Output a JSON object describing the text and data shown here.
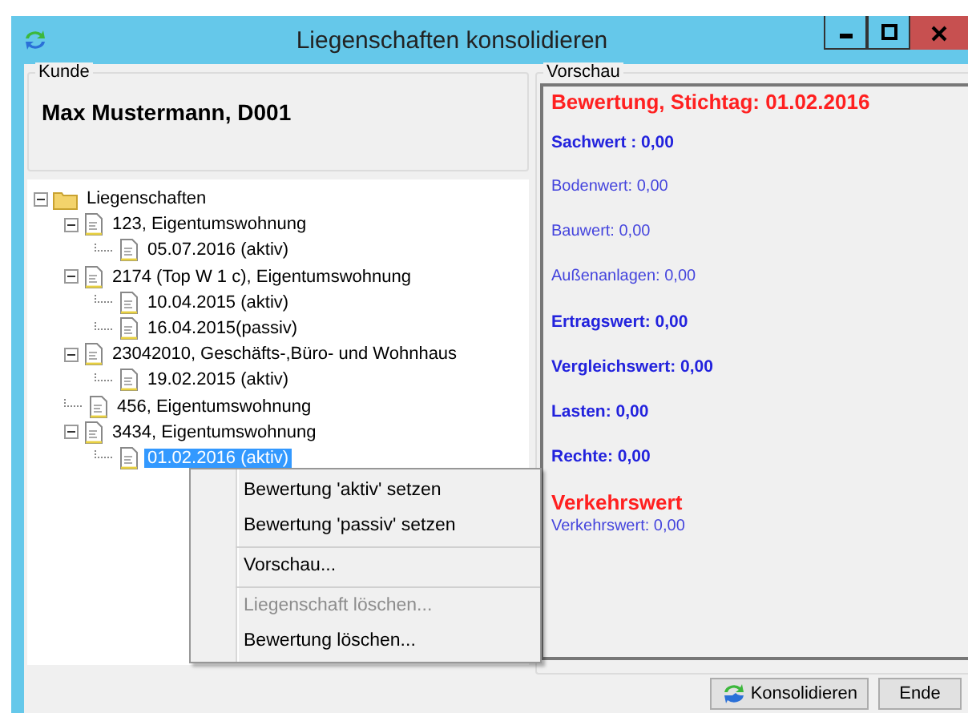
{
  "window": {
    "title": "Liegenschaften konsolidieren"
  },
  "customer": {
    "label": "Kunde",
    "name": "Max Mustermann, D001"
  },
  "tree": [
    {
      "label": "Liegenschaften",
      "kind": "folder",
      "expanded": true,
      "selected": false,
      "children": [
        {
          "label": "123, Eigentumswohnung",
          "kind": "doc",
          "expanded": true,
          "selected": false,
          "children": [
            {
              "label": "05.07.2016 (aktiv)",
              "kind": "doc",
              "selected": false
            }
          ]
        },
        {
          "label": "2174 (Top W 1 c), Eigentumswohnung",
          "kind": "doc",
          "expanded": true,
          "selected": false,
          "children": [
            {
              "label": "10.04.2015 (aktiv)",
              "kind": "doc",
              "selected": false
            },
            {
              "label": "16.04.2015(passiv)",
              "kind": "doc",
              "selected": false
            }
          ]
        },
        {
          "label": "23042010, Geschäfts-,Büro- und Wohnhaus",
          "kind": "doc",
          "expanded": true,
          "selected": false,
          "children": [
            {
              "label": "19.02.2015 (aktiv)",
              "kind": "doc",
              "selected": false
            }
          ]
        },
        {
          "label": "456, Eigentumswohnung",
          "kind": "doc",
          "selected": false
        },
        {
          "label": "3434, Eigentumswohnung",
          "kind": "doc",
          "expanded": true,
          "selected": false,
          "children": [
            {
              "label": "01.02.2016 (aktiv)",
              "kind": "doc",
              "selected": true
            }
          ]
        }
      ]
    }
  ],
  "preview": {
    "label": "Vorschau",
    "lines": [
      {
        "kind": "heading",
        "text": "Bewertung, Stichtag: 01.02.2016"
      },
      {
        "kind": "bold",
        "text": "Sachwert : 0,00"
      },
      {
        "kind": "normal",
        "text": "Bodenwert: 0,00"
      },
      {
        "kind": "normal",
        "text": "Bauwert: 0,00"
      },
      {
        "kind": "normal",
        "text": "Außenanlagen: 0,00"
      },
      {
        "kind": "bold",
        "text": "Ertragswert: 0,00"
      },
      {
        "kind": "bold",
        "text": "Vergleichswert: 0,00"
      },
      {
        "kind": "bold",
        "text": "Lasten: 0,00"
      },
      {
        "kind": "bold",
        "text": "Rechte: 0,00"
      },
      {
        "kind": "heading",
        "text": "Verkehrswert"
      },
      {
        "kind": "sub",
        "text": "Verkehrswert: 0,00"
      }
    ]
  },
  "context_menu": [
    {
      "label": "Bewertung 'aktiv' setzen",
      "disabled": false,
      "separator_before": false
    },
    {
      "label": "Bewertung 'passiv' setzen",
      "disabled": false,
      "separator_before": false
    },
    {
      "label": "Vorschau...",
      "disabled": false,
      "separator_before": true
    },
    {
      "label": "Liegenschaft löschen...",
      "disabled": true,
      "separator_before": true
    },
    {
      "label": "Bewertung löschen...",
      "disabled": false,
      "separator_before": false
    }
  ],
  "buttons": [
    {
      "label": "Konsolidieren",
      "kind": "icon"
    },
    {
      "label": "Ende",
      "kind": "plain"
    }
  ]
}
